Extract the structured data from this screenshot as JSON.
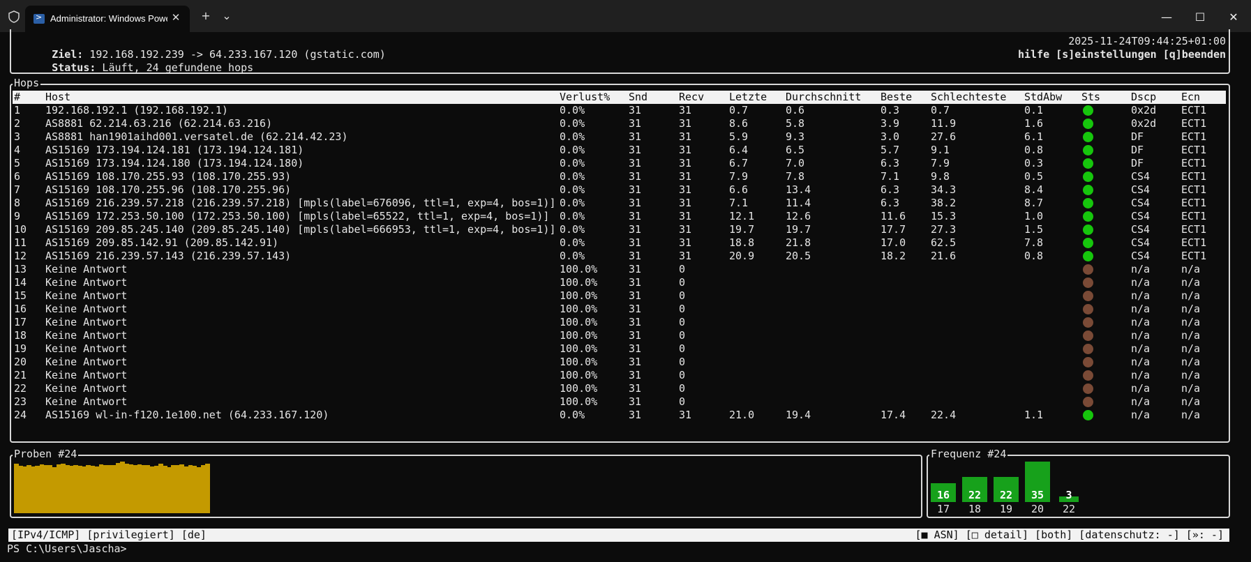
{
  "window": {
    "tab_title": "Administrator: Windows PowerShell",
    "close_tab": "✕",
    "new_tab": "+",
    "dropdown": "⌄",
    "minimize": "—",
    "maximize": "☐",
    "close": "✕"
  },
  "header": {
    "target_label": "Ziel:",
    "target_value": " 192.168.192.239 -> 64.233.167.120 (gstatic.com)",
    "status_label": "Status:",
    "status_value": " Läuft, 24 gefundene hops",
    "timestamp": "2025-11-24T09:44:25+01:00",
    "keys": "hilfe [s]einstellungen [q]beenden"
  },
  "hops": {
    "title": "Hops",
    "columns": [
      "#",
      "Host",
      "Verlust%",
      "Snd",
      "Recv",
      "Letzte",
      "Durchschnitt",
      "Beste",
      "Schlechteste",
      "StdAbw",
      "Sts",
      "Dscp",
      "Ecn"
    ],
    "rows": [
      [
        "1",
        "192.168.192.1 (192.168.192.1)",
        "0.0%",
        "31",
        "31",
        "0.7",
        "0.6",
        "0.3",
        "0.7",
        "0.1",
        "ok",
        "0x2d",
        "ECT1"
      ],
      [
        "2",
        "AS8881 62.214.63.216 (62.214.63.216)",
        "0.0%",
        "31",
        "31",
        "8.6",
        "5.8",
        "3.9",
        "11.9",
        "1.6",
        "ok",
        "0x2d",
        "ECT1"
      ],
      [
        "3",
        "AS8881 han1901aihd001.versatel.de (62.214.42.23)",
        "0.0%",
        "31",
        "31",
        "5.9",
        "9.3",
        "3.0",
        "27.6",
        "6.1",
        "ok",
        "DF",
        "ECT1"
      ],
      [
        "4",
        "AS15169 173.194.124.181 (173.194.124.181)",
        "0.0%",
        "31",
        "31",
        "6.4",
        "6.5",
        "5.7",
        "9.1",
        "0.8",
        "ok",
        "DF",
        "ECT1"
      ],
      [
        "5",
        "AS15169 173.194.124.180 (173.194.124.180)",
        "0.0%",
        "31",
        "31",
        "6.7",
        "7.0",
        "6.3",
        "7.9",
        "0.3",
        "ok",
        "DF",
        "ECT1"
      ],
      [
        "6",
        "AS15169 108.170.255.93 (108.170.255.93)",
        "0.0%",
        "31",
        "31",
        "7.9",
        "7.8",
        "7.1",
        "9.8",
        "0.5",
        "ok",
        "CS4",
        "ECT1"
      ],
      [
        "7",
        "AS15169 108.170.255.96 (108.170.255.96)",
        "0.0%",
        "31",
        "31",
        "6.6",
        "13.4",
        "6.3",
        "34.3",
        "8.4",
        "ok",
        "CS4",
        "ECT1"
      ],
      [
        "8",
        "AS15169 216.239.57.218 (216.239.57.218) [mpls(label=676096, ttl=1, exp=4, bos=1)]",
        "0.0%",
        "31",
        "31",
        "7.1",
        "11.4",
        "6.3",
        "38.2",
        "8.7",
        "ok",
        "CS4",
        "ECT1"
      ],
      [
        "9",
        "AS15169 172.253.50.100 (172.253.50.100) [mpls(label=65522, ttl=1, exp=4, bos=1)]",
        "0.0%",
        "31",
        "31",
        "12.1",
        "12.6",
        "11.6",
        "15.3",
        "1.0",
        "ok",
        "CS4",
        "ECT1"
      ],
      [
        "10",
        "AS15169 209.85.245.140 (209.85.245.140) [mpls(label=666953, ttl=1, exp=4, bos=1)]",
        "0.0%",
        "31",
        "31",
        "19.7",
        "19.7",
        "17.7",
        "27.3",
        "1.5",
        "ok",
        "CS4",
        "ECT1"
      ],
      [
        "11",
        "AS15169 209.85.142.91 (209.85.142.91)",
        "0.0%",
        "31",
        "31",
        "18.8",
        "21.8",
        "17.0",
        "62.5",
        "7.8",
        "ok",
        "CS4",
        "ECT1"
      ],
      [
        "12",
        "AS15169 216.239.57.143 (216.239.57.143)",
        "0.0%",
        "31",
        "31",
        "20.9",
        "20.5",
        "18.2",
        "21.6",
        "0.8",
        "ok",
        "CS4",
        "ECT1"
      ],
      [
        "13",
        "Keine Antwort",
        "100.0%",
        "31",
        "0",
        "",
        "",
        "",
        "",
        "",
        "lost",
        "n/a",
        "n/a"
      ],
      [
        "14",
        "Keine Antwort",
        "100.0%",
        "31",
        "0",
        "",
        "",
        "",
        "",
        "",
        "lost",
        "n/a",
        "n/a"
      ],
      [
        "15",
        "Keine Antwort",
        "100.0%",
        "31",
        "0",
        "",
        "",
        "",
        "",
        "",
        "lost",
        "n/a",
        "n/a"
      ],
      [
        "16",
        "Keine Antwort",
        "100.0%",
        "31",
        "0",
        "",
        "",
        "",
        "",
        "",
        "lost",
        "n/a",
        "n/a"
      ],
      [
        "17",
        "Keine Antwort",
        "100.0%",
        "31",
        "0",
        "",
        "",
        "",
        "",
        "",
        "lost",
        "n/a",
        "n/a"
      ],
      [
        "18",
        "Keine Antwort",
        "100.0%",
        "31",
        "0",
        "",
        "",
        "",
        "",
        "",
        "lost",
        "n/a",
        "n/a"
      ],
      [
        "19",
        "Keine Antwort",
        "100.0%",
        "31",
        "0",
        "",
        "",
        "",
        "",
        "",
        "lost",
        "n/a",
        "n/a"
      ],
      [
        "20",
        "Keine Antwort",
        "100.0%",
        "31",
        "0",
        "",
        "",
        "",
        "",
        "",
        "lost",
        "n/a",
        "n/a"
      ],
      [
        "21",
        "Keine Antwort",
        "100.0%",
        "31",
        "0",
        "",
        "",
        "",
        "",
        "",
        "lost",
        "n/a",
        "n/a"
      ],
      [
        "22",
        "Keine Antwort",
        "100.0%",
        "31",
        "0",
        "",
        "",
        "",
        "",
        "",
        "lost",
        "n/a",
        "n/a"
      ],
      [
        "23",
        "Keine Antwort",
        "100.0%",
        "31",
        "0",
        "",
        "",
        "",
        "",
        "",
        "lost",
        "n/a",
        "n/a"
      ],
      [
        "24",
        "AS15169 wl-in-f120.1e100.net (64.233.167.120)",
        "0.0%",
        "31",
        "31",
        "21.0",
        "19.4",
        "17.4",
        "22.4",
        "1.1",
        "ok",
        "n/a",
        "n/a"
      ]
    ],
    "status_colors": {
      "ok": "#16c60c",
      "lost": "#7a4a36"
    }
  },
  "samples": {
    "title": "Proben #24",
    "color": "#c49a00",
    "values": [
      20.1,
      19.2,
      18.9,
      19.6,
      19.0,
      19.3,
      19.8,
      19.4,
      19.5,
      18.8,
      19.7,
      20.0,
      19.4,
      19.1,
      19.6,
      19.2,
      18.9,
      19.5,
      19.3,
      19.0,
      19.9,
      19.4,
      19.6,
      19.5,
      20.3,
      21.0,
      20.2,
      19.8,
      19.5,
      19.9,
      19.4,
      19.6,
      18.9,
      19.3,
      20.1,
      19.2,
      18.8,
      19.5,
      19.6,
      19.7,
      19.0,
      19.4,
      19.3,
      18.8,
      19.6,
      20.1
    ]
  },
  "frequency": {
    "title": "Frequenz #24",
    "color": "#17a11b",
    "bins": [
      {
        "label": "17",
        "count": "16"
      },
      {
        "label": "18",
        "count": "22"
      },
      {
        "label": "19",
        "count": "22"
      },
      {
        "label": "20",
        "count": "35"
      },
      {
        "label": "22",
        "count": "3"
      }
    ]
  },
  "statusbar": {
    "left": "[IPv4/ICMP] [privilegiert] [de]",
    "right": "[■ ASN] [□ detail] [both] [datenschutz: -] [»: -]"
  },
  "prompt": "PS C:\\Users\\Jascha>"
}
